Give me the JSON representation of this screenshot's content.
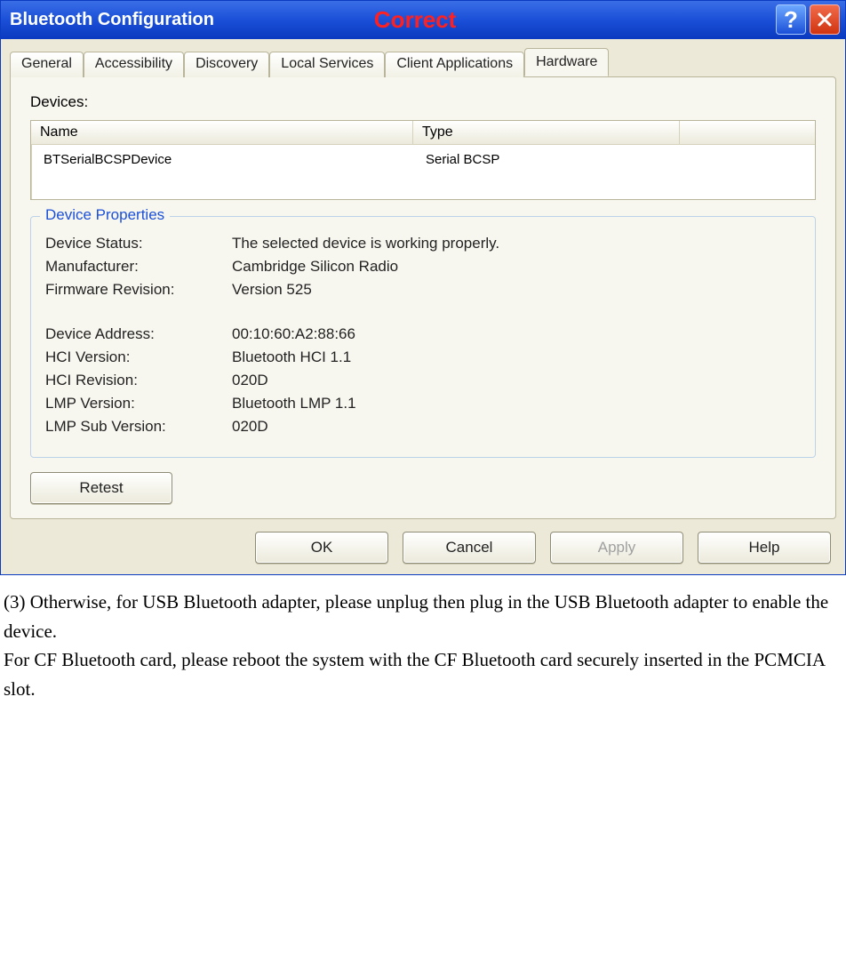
{
  "window": {
    "title": "Bluetooth Configuration",
    "annotation": "Correct"
  },
  "tabs": [
    {
      "label": "General"
    },
    {
      "label": "Accessibility"
    },
    {
      "label": "Discovery"
    },
    {
      "label": "Local Services"
    },
    {
      "label": "Client Applications"
    },
    {
      "label": "Hardware"
    }
  ],
  "devices": {
    "heading": "Devices:",
    "columns": {
      "name": "Name",
      "type": "Type"
    },
    "rows": [
      {
        "name": "BTSerialBCSPDevice",
        "type": "Serial BCSP"
      }
    ]
  },
  "device_properties": {
    "legend": "Device Properties",
    "status_label": "Device Status:",
    "status_value": "The selected device is working properly.",
    "manufacturer_label": "Manufacturer:",
    "manufacturer_value": "Cambridge Silicon Radio",
    "firmware_label": "Firmware Revision:",
    "firmware_value": "Version 525",
    "address_label": "Device Address:",
    "address_value": "00:10:60:A2:88:66",
    "hci_version_label": "HCI Version:",
    "hci_version_value": "Bluetooth HCI 1.1",
    "hci_revision_label": "HCI Revision:",
    "hci_revision_value": "020D",
    "lmp_version_label": "LMP Version:",
    "lmp_version_value": "Bluetooth LMP 1.1",
    "lmp_sub_label": "LMP Sub Version:",
    "lmp_sub_value": "020D"
  },
  "buttons": {
    "retest": "Retest",
    "ok": "OK",
    "cancel": "Cancel",
    "apply": "Apply",
    "help": "Help"
  },
  "instructions": {
    "line1": "(3) Otherwise, for USB Bluetooth adapter, please unplug then plug in the USB Bluetooth adapter to enable the device.",
    "line2": "For CF Bluetooth card, please reboot the system with the CF Bluetooth card securely inserted in the PCMCIA slot."
  }
}
